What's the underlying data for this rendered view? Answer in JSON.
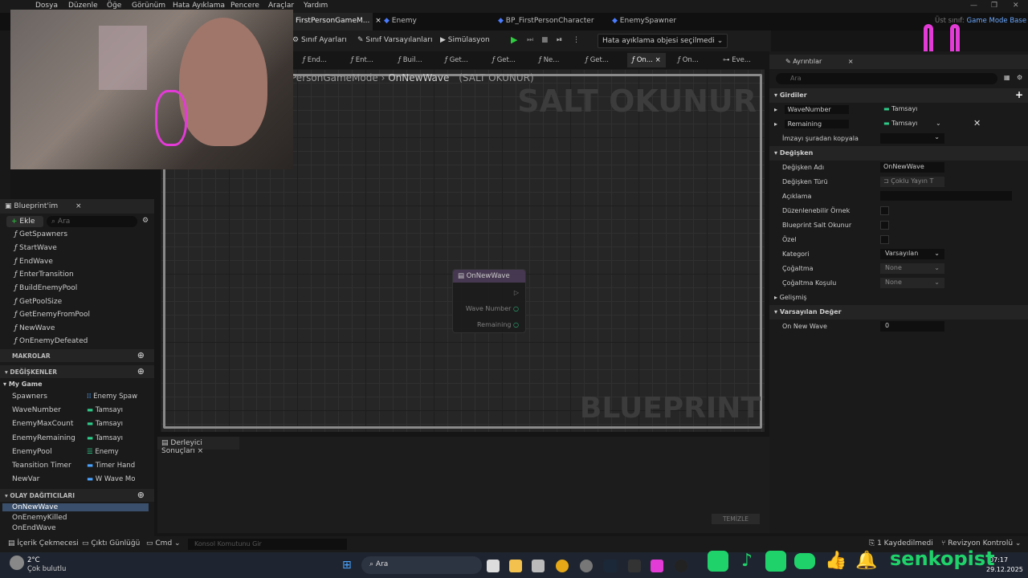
{
  "menu": [
    "Dosya",
    "Düzenle",
    "Öğe",
    "Görünüm",
    "Hata Ayıklama",
    "Pencere",
    "Araçlar",
    "Yardım"
  ],
  "tabs": [
    {
      "label": "FirstPersonGameM...",
      "active": true,
      "closable": "×"
    },
    {
      "label": "Enemy",
      "active": false
    },
    {
      "label": "BP_FirstPersonCharacter",
      "active": false
    },
    {
      "label": "EnemySpawner",
      "active": false
    }
  ],
  "parent_class": {
    "label": "Üst sınıf:",
    "value": "Game Mode Base"
  },
  "toolbar": {
    "class_settings": "Sınıf Ayarları",
    "class_defaults": "Sınıf Varsayılanları",
    "simulation": "Simülasyon",
    "debug_object": "Hata ayıklama objesi seçilmedi"
  },
  "function_tabs": [
    "End...",
    "Ent...",
    "Buil...",
    "Get...",
    "Get...",
    "Ne...",
    "Get...",
    "On...",
    "On...",
    "Eve..."
  ],
  "graph": {
    "breadcrumb_owner": "PersonGameMode",
    "breadcrumb_sep": "›",
    "breadcrumb_item": "OnNewWave",
    "breadcrumb_readonly": "(SALT OKUNUR)",
    "watermark_top": "SALT OKUNUR",
    "watermark_bottom": "BLUEPRINT",
    "node": {
      "title": "OnNewWave",
      "pins": [
        "Wave Number",
        "Remaining"
      ]
    }
  },
  "details": {
    "title": "Ayrıntılar",
    "search_placeholder": "Ara",
    "inputs_header": "Girdiler",
    "inputs": [
      {
        "name": "WaveNumber",
        "type": "Tamsayı"
      },
      {
        "name": "Remaining",
        "type": "Tamsayı"
      }
    ],
    "copy_signature": "İmzayı şuradan kopyala",
    "variable_header": "Değişken",
    "variable_rows": [
      {
        "label": "Değişken Adı",
        "value": "OnNewWave"
      },
      {
        "label": "Değişken Türü",
        "value": "Çoklu Yayın T"
      },
      {
        "label": "Açıklama",
        "value": ""
      },
      {
        "label": "Düzenlenebilir Örnek",
        "value": ""
      },
      {
        "label": "Blueprint Salt Okunur",
        "value": ""
      },
      {
        "label": "Özel",
        "value": ""
      },
      {
        "label": "Kategori",
        "value": "Varsayılan"
      },
      {
        "label": "Çoğaltma",
        "value": "None"
      },
      {
        "label": "Çoğaltma Koşulu",
        "value": "None"
      }
    ],
    "advanced": "Gelişmiş",
    "default_header": "Varsayılan Değer",
    "default_row": {
      "label": "On New Wave",
      "value": "0"
    }
  },
  "my_blueprint": {
    "title": "Blueprint'im",
    "add": "Ekle",
    "search_placeholder": "Ara",
    "functions": [
      "GetSpawners",
      "StartWave",
      "EndWave",
      "EnterTransition",
      "BuildEnemyPool",
      "GetPoolSize",
      "GetEnemyFromPool",
      "NewWave",
      "OnEnemyDefeated"
    ],
    "macros": "MAKROLAR",
    "variables_header": "DEĞİŞKENLER",
    "category": "My Game",
    "variables": [
      {
        "name": "Spawners",
        "type": "Enemy Spaw"
      },
      {
        "name": "WaveNumber",
        "type": "Tamsayı"
      },
      {
        "name": "EnemyMaxCount",
        "type": "Tamsayı"
      },
      {
        "name": "EnemyRemaining",
        "type": "Tamsayı"
      },
      {
        "name": "EnemyPool",
        "type": "Enemy"
      },
      {
        "name": "Teansition Timer",
        "type": "Timer Hand"
      },
      {
        "name": "NewVar",
        "type": "W Wave Mo"
      }
    ],
    "dispatchers_header": "OLAY DAĞITICILARI",
    "dispatchers": [
      "OnNewWave",
      "OnEnemyKilled",
      "OnEndWave"
    ]
  },
  "compiler": {
    "tab": "Derleyici Sonuçları",
    "clear": "TEMİZLE"
  },
  "statusbar": {
    "content_drawer": "İçerik Çekmecesi",
    "output_log": "Çıktı Günlüğü",
    "cmd": "Cmd",
    "console_placeholder": "Konsol Komutunu Gir",
    "saved": "1 Kaydedilmedi",
    "revision": "Revizyon Kontrolü"
  },
  "taskbar": {
    "temp": "2°C",
    "weather": "Çok bulutlu",
    "search": "Ara",
    "time": "07:17",
    "date": "29.12.2025"
  },
  "overlay": {
    "channel": "senkopist"
  },
  "colors": {
    "accent": "#1fd36a",
    "pink": "#e23bd6",
    "node_header": "#4a3a55"
  }
}
